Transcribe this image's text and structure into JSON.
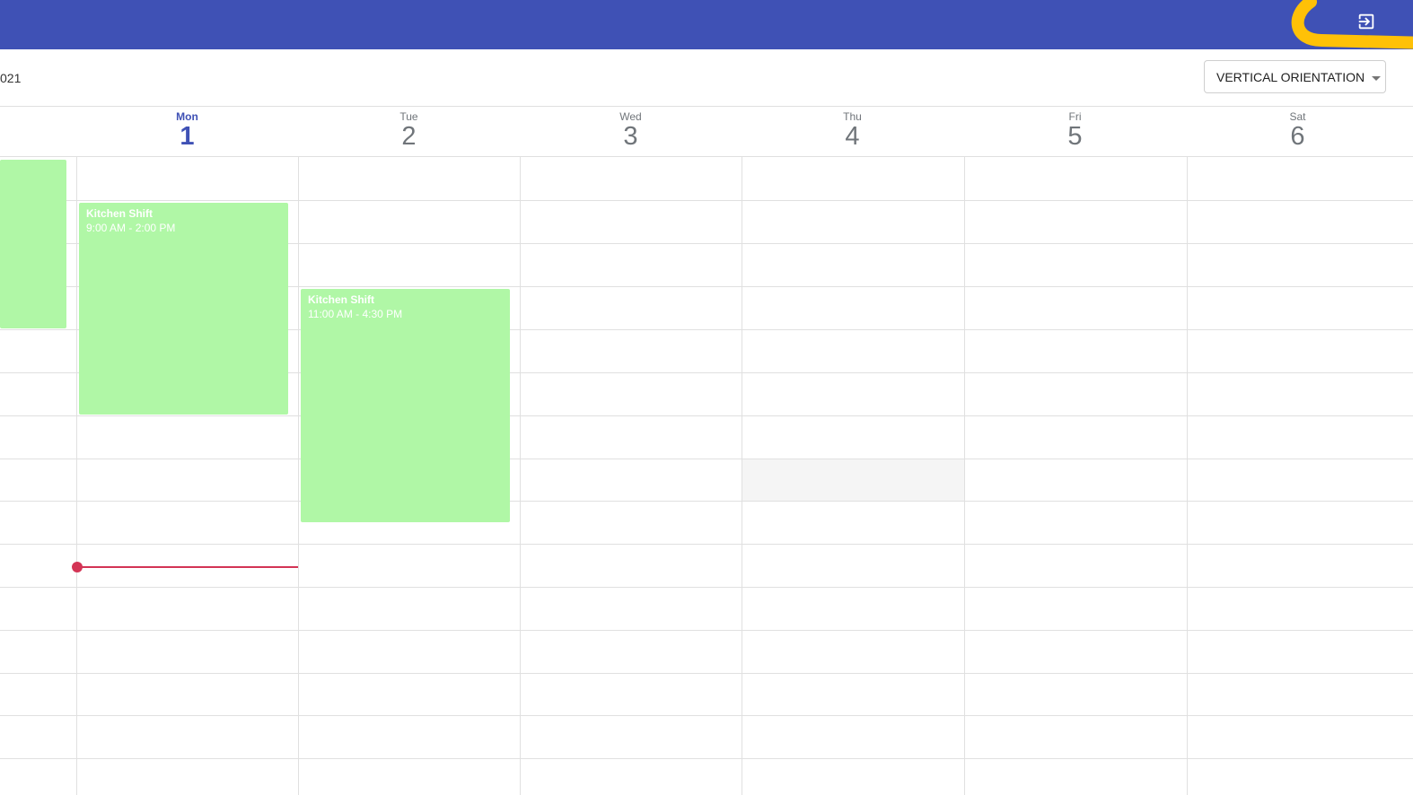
{
  "appbar": {
    "color": "#3f51b5",
    "logout_icon": "login-icon",
    "annotation_color": "#ffc107"
  },
  "toolbar": {
    "month_label": "021",
    "orientation_select": "VERTICAL ORIENTATION"
  },
  "days": [
    {
      "weekday": "Mon",
      "date": "1",
      "today": true
    },
    {
      "weekday": "Tue",
      "date": "2",
      "today": false
    },
    {
      "weekday": "Wed",
      "date": "3",
      "today": false
    },
    {
      "weekday": "Thu",
      "date": "4",
      "today": false
    },
    {
      "weekday": "Fri",
      "date": "5",
      "today": false
    },
    {
      "weekday": "Sat",
      "date": "6",
      "today": false
    }
  ],
  "events": [
    {
      "title": "Kitchen Shift",
      "time": "9:00 AM  -  2:00 PM",
      "day": "Mon",
      "color": "#b0f7a6"
    },
    {
      "title": "Kitchen Shift",
      "time": "11:00 AM  -  4:30 PM",
      "day": "Tue",
      "color": "#b0f7a6"
    }
  ],
  "now_indicator_color": "#d33455"
}
